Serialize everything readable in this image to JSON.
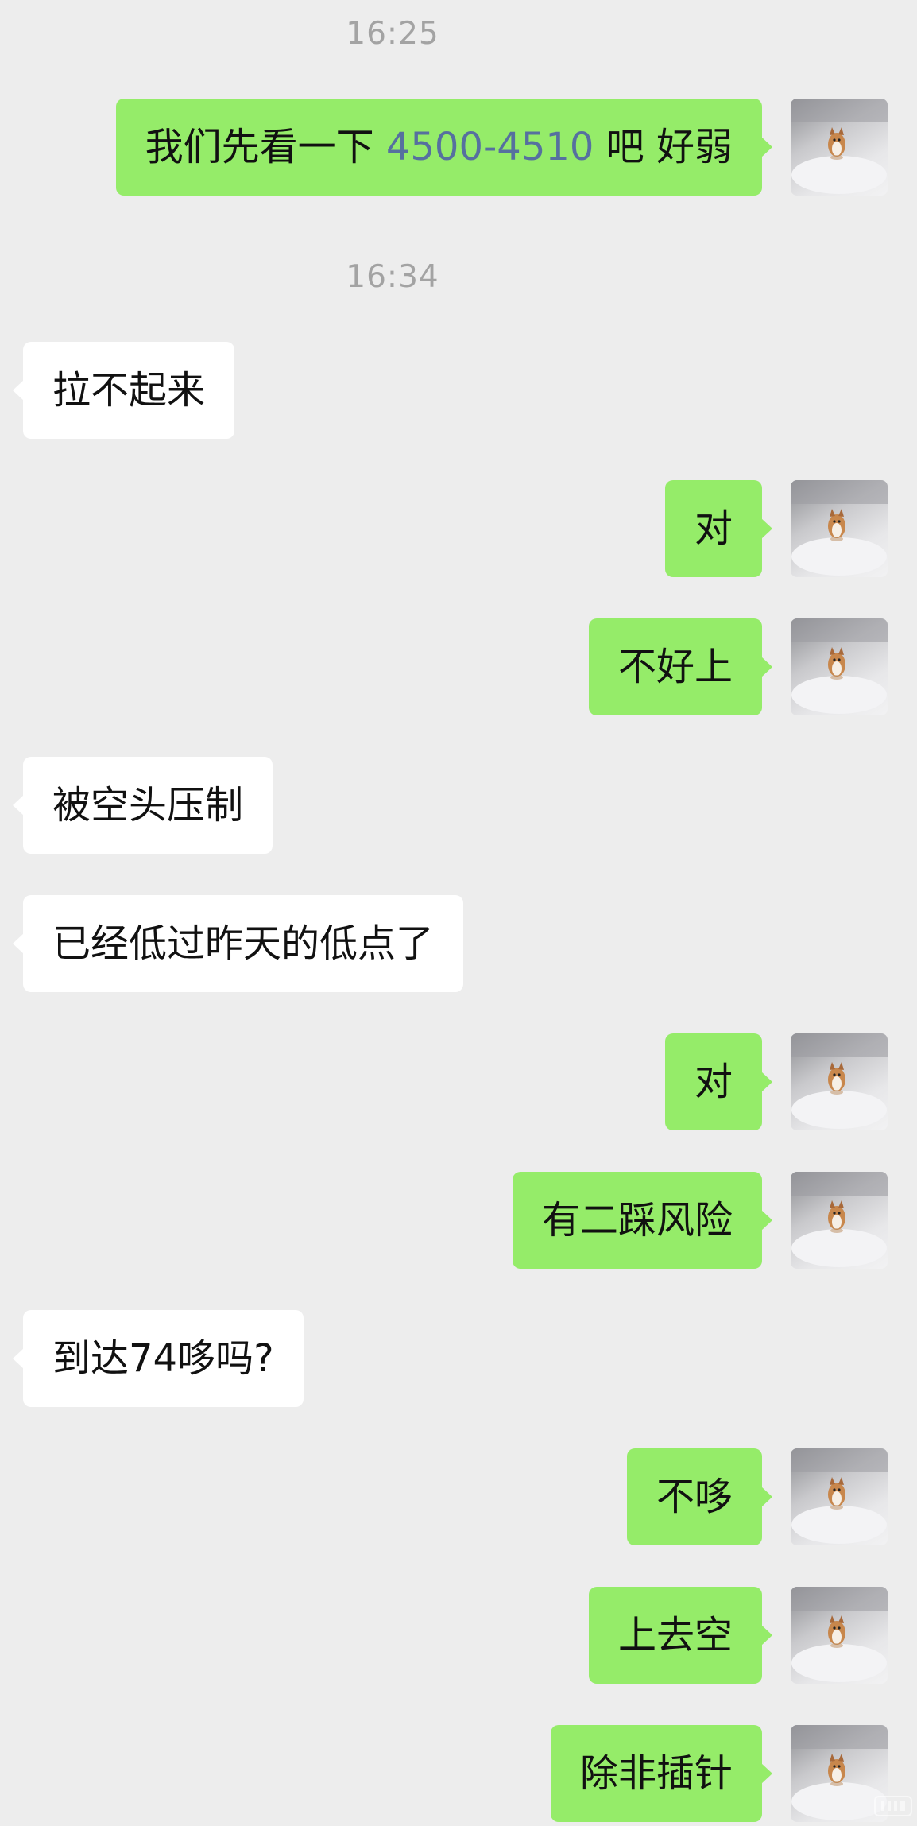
{
  "chat": {
    "timestamps": [
      "16:25",
      "16:34"
    ],
    "messages": [
      {
        "side": "right",
        "text_before": "我们先看一下 ",
        "highlight": "4500-4510",
        "text_after": " 吧  好弱"
      },
      {
        "side": "left",
        "text": "拉不起来"
      },
      {
        "side": "right",
        "text": "对"
      },
      {
        "side": "right",
        "text": "不好上"
      },
      {
        "side": "left",
        "text": "被空头压制"
      },
      {
        "side": "left",
        "text": "已经低过昨天的低点了"
      },
      {
        "side": "right",
        "text": "对"
      },
      {
        "side": "right",
        "text": "有二踩风险"
      },
      {
        "side": "left",
        "text": "到达74哆吗?"
      },
      {
        "side": "right",
        "text": "不哆"
      },
      {
        "side": "right",
        "text": "上去空"
      },
      {
        "side": "right",
        "text": "除非插针"
      }
    ]
  },
  "colors": {
    "background": "#ededed",
    "sent_bubble": "#95ec69",
    "received_bubble": "#ffffff",
    "highlight_text": "#56709f",
    "timestamp_text": "#a3a3a3"
  },
  "icons": {
    "avatar": "corgi-in-snow-avatar-icon",
    "watermark": "watermark-icon"
  }
}
